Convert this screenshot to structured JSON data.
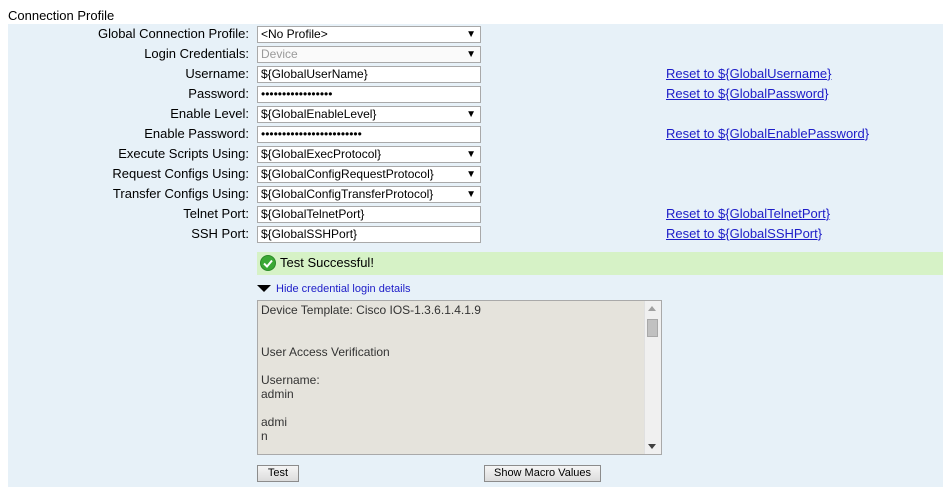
{
  "section_title": "Connection Profile",
  "fields": [
    {
      "label": "Global Connection Profile:",
      "type": "select",
      "value": "<No Profile>",
      "disabled": false,
      "reset": ""
    },
    {
      "label": "Login Credentials:",
      "type": "select",
      "value": "Device",
      "disabled": true,
      "reset": ""
    },
    {
      "label": "Username:",
      "type": "input",
      "value": "${GlobalUserName}",
      "reset": "Reset to ${GlobalUsername}"
    },
    {
      "label": "Password:",
      "type": "input",
      "value": "•••••••••••••••••",
      "reset": "Reset to ${GlobalPassword}"
    },
    {
      "label": "Enable Level:",
      "type": "select",
      "value": "${GlobalEnableLevel}",
      "disabled": false,
      "reset": ""
    },
    {
      "label": "Enable Password:",
      "type": "input",
      "value": "••••••••••••••••••••••••",
      "reset": "Reset to ${GlobalEnablePassword}"
    },
    {
      "label": "Execute Scripts Using:",
      "type": "select",
      "value": "${GlobalExecProtocol}",
      "disabled": false,
      "reset": ""
    },
    {
      "label": "Request Configs Using:",
      "type": "select",
      "value": "${GlobalConfigRequestProtocol}",
      "disabled": false,
      "reset": ""
    },
    {
      "label": "Transfer Configs Using:",
      "type": "select",
      "value": "${GlobalConfigTransferProtocol}",
      "disabled": false,
      "reset": ""
    },
    {
      "label": "Telnet Port:",
      "type": "input",
      "value": "${GlobalTelnetPort}",
      "reset": "Reset to ${GlobalTelnetPort}"
    },
    {
      "label": "SSH Port:",
      "type": "input",
      "value": "${GlobalSSHPort}",
      "reset": "Reset to ${GlobalSSHPort}"
    }
  ],
  "status": {
    "text": "Test Successful!",
    "icon": "check-circle-icon",
    "color": "#d6f2c6"
  },
  "details_toggle": "Hide credential login details",
  "log_text": "Device Template: Cisco IOS-1.3.6.1.4.1.9\n\n\nUser Access Verification\n\nUsername:\nadmin\n\nadmi\nn",
  "buttons": {
    "test": "Test",
    "show_macro_values": "Show Macro Values"
  },
  "colors": {
    "panel_bg": "#e7f1f8",
    "link": "#1c1cc8",
    "success_bg": "#d6f2c6"
  }
}
